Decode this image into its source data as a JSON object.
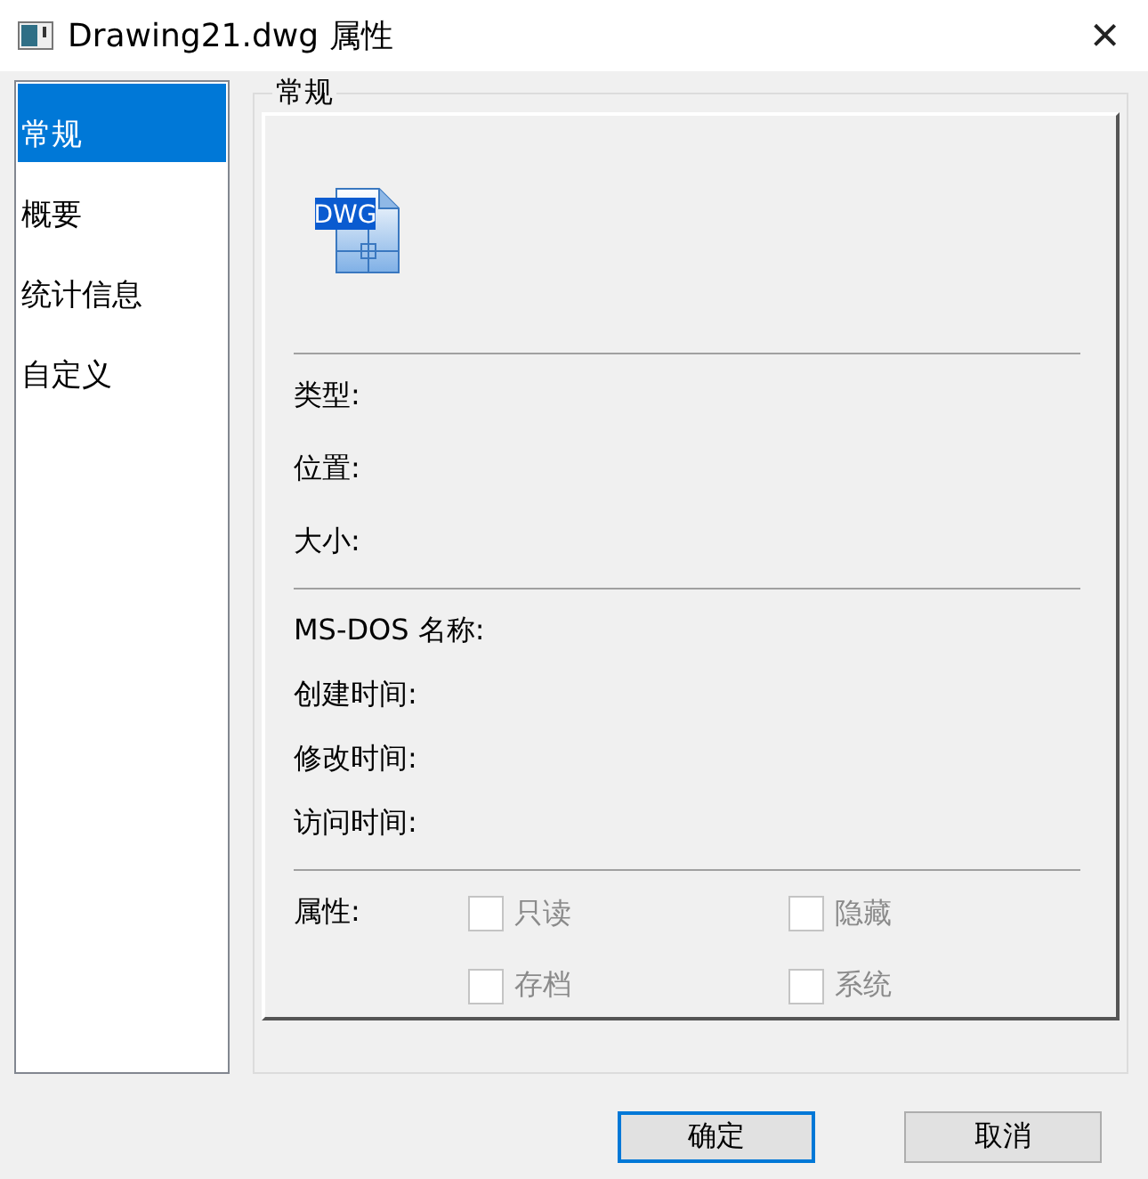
{
  "window": {
    "title": "Drawing21.dwg 属性",
    "close": "×"
  },
  "sidebar": {
    "items": [
      {
        "label": "常规",
        "selected": true
      },
      {
        "label": "概要",
        "selected": false
      },
      {
        "label": "统计信息",
        "selected": false
      },
      {
        "label": "自定义",
        "selected": false
      }
    ]
  },
  "group": {
    "title": "常规",
    "icon_label": "DWG",
    "sections": [
      [
        {
          "label": "类型:"
        },
        {
          "label": "位置:"
        },
        {
          "label": "大小:"
        }
      ],
      [
        {
          "label": "MS-DOS 名称:"
        },
        {
          "label": "创建时间:"
        },
        {
          "label": "修改时间:"
        },
        {
          "label": "访问时间:"
        }
      ]
    ],
    "attributes": {
      "label": "属性:",
      "options": [
        {
          "label": "只读",
          "checked": false,
          "disabled": true
        },
        {
          "label": "隐藏",
          "checked": false,
          "disabled": true
        },
        {
          "label": "存档",
          "checked": false,
          "disabled": true
        },
        {
          "label": "系统",
          "checked": false,
          "disabled": true
        }
      ]
    }
  },
  "buttons": [
    {
      "label": "确定",
      "selected": true
    },
    {
      "label": "取消",
      "selected": false
    }
  ]
}
